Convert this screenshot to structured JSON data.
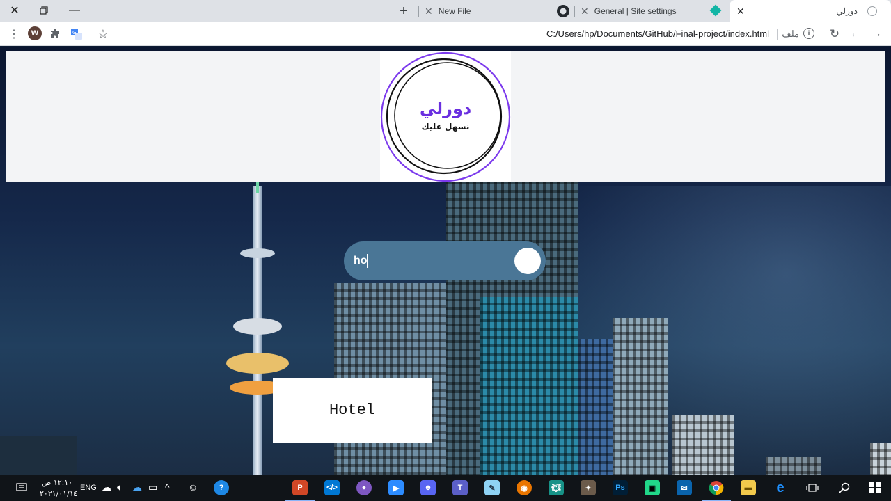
{
  "browser": {
    "tabs": [
      {
        "title": "دورلي",
        "state": "active"
      },
      {
        "title": "General | Site settings"
      },
      {
        "title": "New File"
      }
    ],
    "new_tab_icon": "plus-icon",
    "address_bar": {
      "url": "C:/Users/hp/Documents/GitHub/Final-project/index.html",
      "scheme_label": "ملف"
    },
    "profile_initial": "W"
  },
  "page": {
    "logo": {
      "title": "دورلي",
      "subtitle": "نسهل عليك"
    },
    "search": {
      "value": "ho"
    },
    "result": {
      "label": "Hotel"
    }
  },
  "taskbar": {
    "time": "١٢:١٠ ص",
    "date": "٢٠٢١/٠١/١٤",
    "language": "ENG",
    "apps": [
      "windows-start",
      "search",
      "task-view",
      "edge",
      "file-explorer",
      "chrome",
      "mail",
      "jetbrains",
      "photoshop",
      "gimp",
      "gitkraken",
      "blender",
      "notepad",
      "teams",
      "discord",
      "zoom",
      "obs",
      "vscode",
      "powerpoint"
    ]
  },
  "colors": {
    "header_bg": "#f3f4f6",
    "logo_ring": "#7c3aed",
    "logo_title": "#6a2fe0",
    "search_pill": "#4a7696",
    "taskbar_bg": "#101418"
  }
}
